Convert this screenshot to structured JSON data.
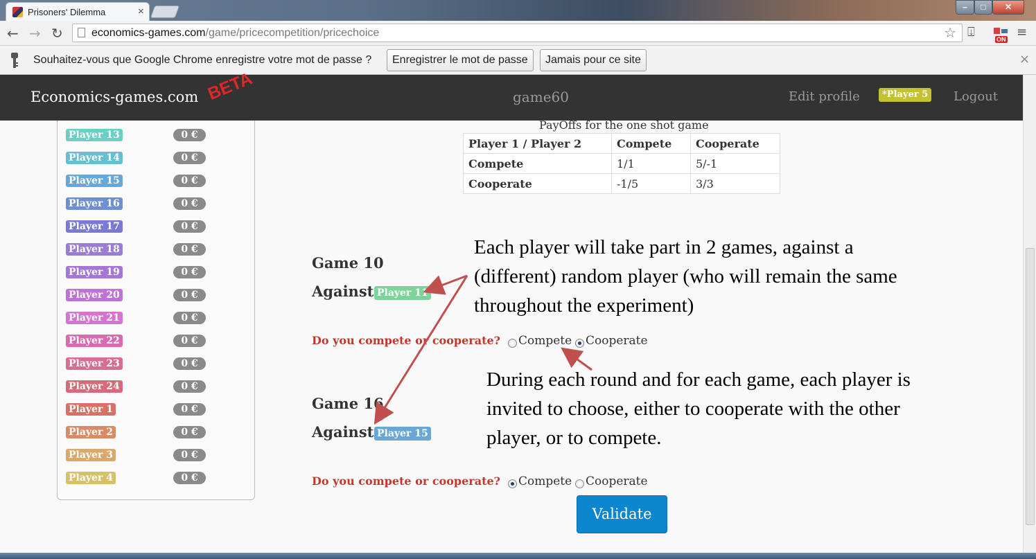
{
  "browser": {
    "tab_title": "Prisoners' Dilemma",
    "url_host": "economics-games.com",
    "url_path": "/game/pricecompetition/pricechoice",
    "infobar": {
      "text": "Souhaitez-vous que Google Chrome enregistre votre mot de passe ?",
      "save_button": "Enregistrer le mot de passe",
      "never_button": "Jamais pour ce site"
    },
    "ext_badge": "ON"
  },
  "navbar": {
    "brand": "Economics-games.com",
    "beta": "BETA",
    "game_name": "game60",
    "edit_profile": "Edit profile",
    "player_badge": "*Player 5",
    "logout": "Logout"
  },
  "sidebar": {
    "players": [
      {
        "name": "Player 13",
        "score": "0 €",
        "color": "#6ccfc4"
      },
      {
        "name": "Player 14",
        "score": "0 €",
        "color": "#66bfd1"
      },
      {
        "name": "Player 15",
        "score": "0 €",
        "color": "#69a8d6"
      },
      {
        "name": "Player 16",
        "score": "0 €",
        "color": "#6e8fd0"
      },
      {
        "name": "Player 17",
        "score": "0 €",
        "color": "#7a7ad4"
      },
      {
        "name": "Player 18",
        "score": "0 €",
        "color": "#9a7cd2"
      },
      {
        "name": "Player 19",
        "score": "0 €",
        "color": "#a476d6"
      },
      {
        "name": "Player 20",
        "score": "0 €",
        "color": "#bf72d6"
      },
      {
        "name": "Player 21",
        "score": "0 €",
        "color": "#d574cf"
      },
      {
        "name": "Player 22",
        "score": "0 €",
        "color": "#d86ab0"
      },
      {
        "name": "Player 23",
        "score": "0 €",
        "color": "#d86d93"
      },
      {
        "name": "Player 24",
        "score": "0 €",
        "color": "#d36c78"
      },
      {
        "name": "Player 1",
        "score": "0 €",
        "color": "#d77166"
      },
      {
        "name": "Player 2",
        "score": "0 €",
        "color": "#d98a66"
      },
      {
        "name": "Player 3",
        "score": "0 €",
        "color": "#d9a86a"
      },
      {
        "name": "Player 4",
        "score": "0 €",
        "color": "#d6c06a"
      }
    ]
  },
  "payoffs": {
    "title": "PayOffs for the one shot game",
    "headers": [
      "Player 1 / Player 2",
      "Compete",
      "Cooperate"
    ],
    "rows": [
      [
        "Compete",
        "1/1",
        "5/-1"
      ],
      [
        "Cooperate",
        "-1/5",
        "3/3"
      ]
    ]
  },
  "games": [
    {
      "title": "Game 10",
      "against_label": "Against",
      "opponent": "Player 11",
      "opponent_color": "#7dd49a",
      "question": "Do you compete or cooperate?",
      "option_compete": "Compete",
      "option_cooperate": "Cooperate",
      "selected": "Cooperate"
    },
    {
      "title": "Game 16",
      "against_label": "Against",
      "opponent": "Player 15",
      "opponent_color": "#69a8d6",
      "question": "Do you compete or cooperate?",
      "option_compete": "Compete",
      "option_cooperate": "Cooperate",
      "selected": "Compete"
    }
  ],
  "validate_label": "Validate",
  "annotations": {
    "top": [
      "Each player will take part in 2 games, against a",
      "(different) random player (who will remain the same",
      "throughout the experiment)"
    ],
    "bottom": [
      "During each round and for each game, each player is",
      "invited to choose, either to cooperate with the other",
      "player, or to compete."
    ]
  },
  "colors": {
    "navbar_bg": "#333333",
    "question_red": "#c0392b",
    "validate_blue": "#0c86cf",
    "annotation_arrow": "#c0504d"
  }
}
